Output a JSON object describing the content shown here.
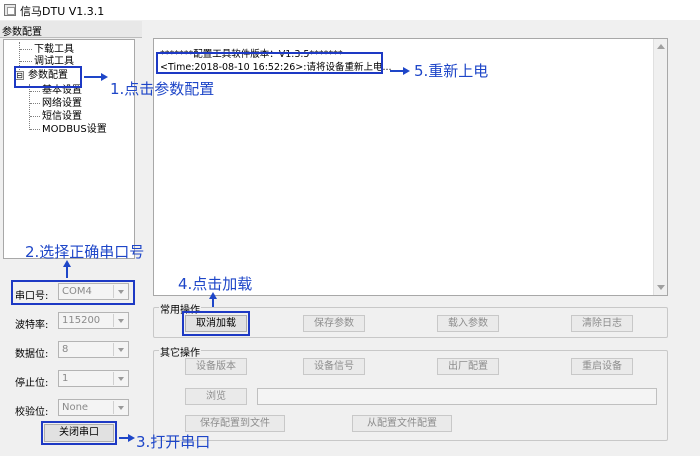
{
  "window": {
    "title": "信马DTU V1.3.1"
  },
  "left_panel": {
    "header": "参数配置",
    "tree": [
      {
        "label": "下载工具"
      },
      {
        "label": "调试工具"
      },
      {
        "label": "参数配置",
        "expander": "⊟"
      },
      {
        "label": "基本设置"
      },
      {
        "label": "网络设置"
      },
      {
        "label": "短信设置"
      },
      {
        "label": "MODBUS设置"
      }
    ],
    "fields": [
      {
        "label": "串口号:",
        "value": "COM4"
      },
      {
        "label": "波特率:",
        "value": "115200"
      },
      {
        "label": "数据位:",
        "value": "8"
      },
      {
        "label": "停止位:",
        "value": "1"
      },
      {
        "label": "校验位:",
        "value": "None"
      }
    ],
    "close_port_button": "关闭串口"
  },
  "log": {
    "lines": [
      "*******配置工具软件版本：V1.3.5*******",
      "<Time:2018-08-10 16:52:26>:请将设备重新上电..."
    ]
  },
  "common_ops": {
    "title": "常用操作",
    "buttons": [
      "取消加载",
      "保存参数",
      "载入参数",
      "清除日志"
    ]
  },
  "other_ops": {
    "title": "其它操作",
    "row1": [
      "设备版本",
      "设备信号",
      "出厂配置",
      "重启设备"
    ],
    "browse_button": "浏览",
    "browse_path": "",
    "row3": [
      "保存配置到文件",
      "从配置文件配置"
    ]
  },
  "annotations": {
    "step1": "1.点击参数配置",
    "step2": "2.选择正确串口号",
    "step3": "3.打开串口",
    "step4": "4.点击加载",
    "step5": "5.重新上电",
    "color": "#1e46c8"
  }
}
